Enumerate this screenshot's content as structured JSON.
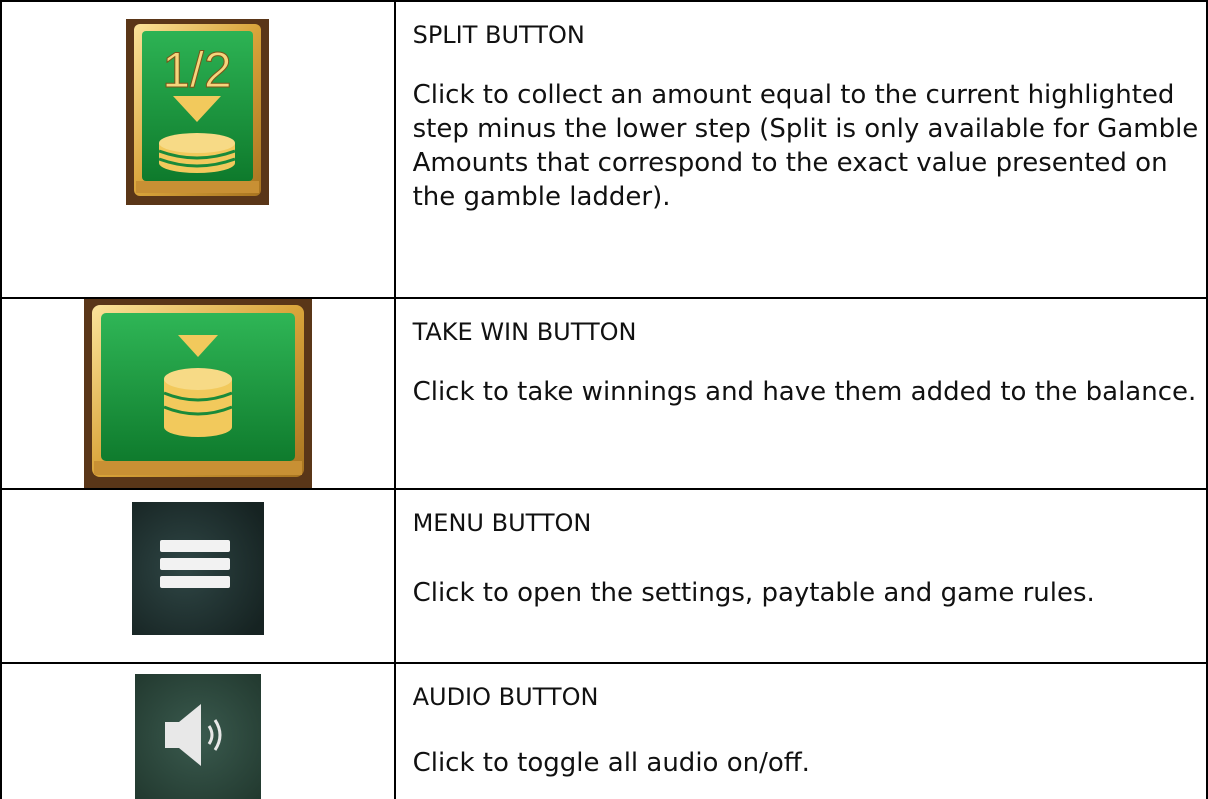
{
  "rows": [
    {
      "icon": "split-half-coin-icon",
      "icon_text": "1/2",
      "title": "SPLIT BUTTON",
      "description": "Click to collect an amount equal to the current highlighted step minus the lower step (Split is only available for Gamble Amounts that correspond to the exact value presented on the gamble ladder)."
    },
    {
      "icon": "take-win-coin-stack-icon",
      "title": "TAKE WIN BUTTON",
      "description": "Click to take winnings and have them added to the balance."
    },
    {
      "icon": "hamburger-menu-icon",
      "title": "MENU BUTTON",
      "description": "Click to open the settings, paytable and game rules."
    },
    {
      "icon": "speaker-audio-icon",
      "title": "AUDIO BUTTON",
      "description": "Click to toggle all audio on/off."
    }
  ],
  "colors": {
    "green": "#1e9a3c",
    "gold": "#e8b84a",
    "dark_brown": "#4a2e12",
    "dark_teal": "#213433",
    "audio_bg": "#2c4a40"
  }
}
